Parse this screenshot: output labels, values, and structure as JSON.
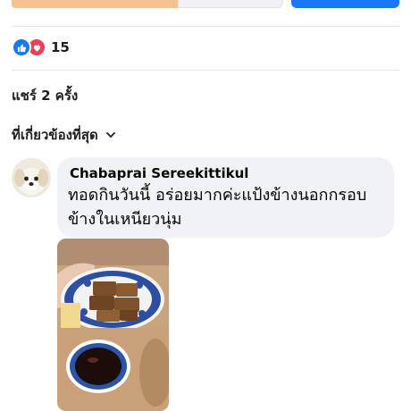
{
  "reactions": {
    "count": "15",
    "icons": [
      "like-icon",
      "love-icon"
    ]
  },
  "shares": {
    "label": "แชร์ 2 ครั้ง"
  },
  "sort": {
    "label": "ที่เกี่ยวข้องที่สุด",
    "icon": "chevron-down-icon"
  },
  "comment": {
    "author": "Chabaprai Sereekittikul",
    "text": "ทอดกินวันนี้ อร่อยมากค่ะแป้งข้างนอกกรอบข้างในเหนียวนุ่ม"
  },
  "colors": {
    "accent": "#1877f2",
    "love": "#f33e58",
    "bubble": "#f0f2f5"
  }
}
